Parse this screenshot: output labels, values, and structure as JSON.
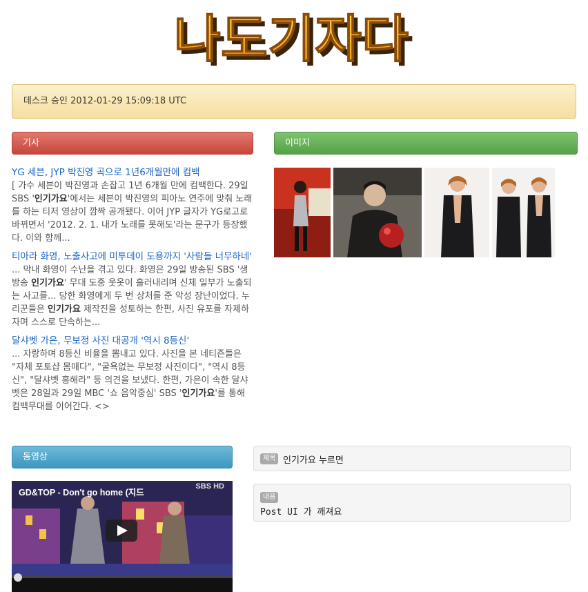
{
  "logo_text": "나도기자다",
  "alert": {
    "text": "데스크 승인 2012-01-29 15:09:18 UTC"
  },
  "sections": {
    "articles": "기사",
    "images": "이미지",
    "video": "동영상"
  },
  "articles": [
    {
      "title": "YG 세븐, JYP 박진영 곡으로 1년6개월만에 컴백",
      "body_before": "[ 가수 세븐이 박진영과 손잡고 1년 6개월 만에 컴백한다. 29일 SBS '",
      "body_bold": "인기가요",
      "body_after": "'에서는 세븐이 박진영의 피아노 연주에 맞춰 노래를 하는 티저 영상이 깜짝 공개됐다. 이어 JYP 글자가 YG로고로 바뀌면서 '2012. 2. 1. 내가 노래를 못해도'라는 문구가 등장했다. 이와 함께..."
    },
    {
      "title": "티아라 화영, 노출사고에 미투데이 도용까지 '사람들 너무하네'",
      "body_p1": "... 막내 화영이 수난을 겪고 있다. 화영은 29일 방송된 SBS '생방송 ",
      "body_b1": "인기가요",
      "body_p2": "' 무대 도중 웃옷이 흘러내리며 신체 일부가 노출되는 사고를... 당한 화영에게 두 번 상처를 준 악성 장난이었다. 누리꾼들은 ",
      "body_b2": "인기가요",
      "body_p3": " 제작진을 성토하는 한편, 사진 유포를 자제하자며 스스로 단속하는..."
    },
    {
      "title": "달샤벳 가은, 무보정 사진 대공개 '역시 8등신'",
      "body_before": "... 자랑하며 8등신 비율을 뽐내고 있다. 사진을 본 네티즌들은 \"자체 포토샵 몸매다\", \"굴욕없는 무보정 사진이다\", \"역시 8등신\", \"달샤벳 홍해라\" 등 의견을 보냈다. 한편, 가은이 속한 달샤벳은 28일과 29일 MBC '쇼 음악중심' SBS '",
      "body_bold": "인기가요",
      "body_after": "'를 통해 컴백무대를 이어간다. <>"
    }
  ],
  "video": {
    "title": "GD&TOP - Don't go home (지드",
    "channel_logo": "SBS HD"
  },
  "post": {
    "title_tag": "제목",
    "title_value": "인기가요 누르면",
    "content_tag": "내용",
    "content_value": "Post UI 가 깨져요"
  },
  "colors": {
    "articles_bar": "#c9453a",
    "images_bar": "#54a146",
    "video_bar": "#3b97c0",
    "link": "#1a64c4"
  }
}
